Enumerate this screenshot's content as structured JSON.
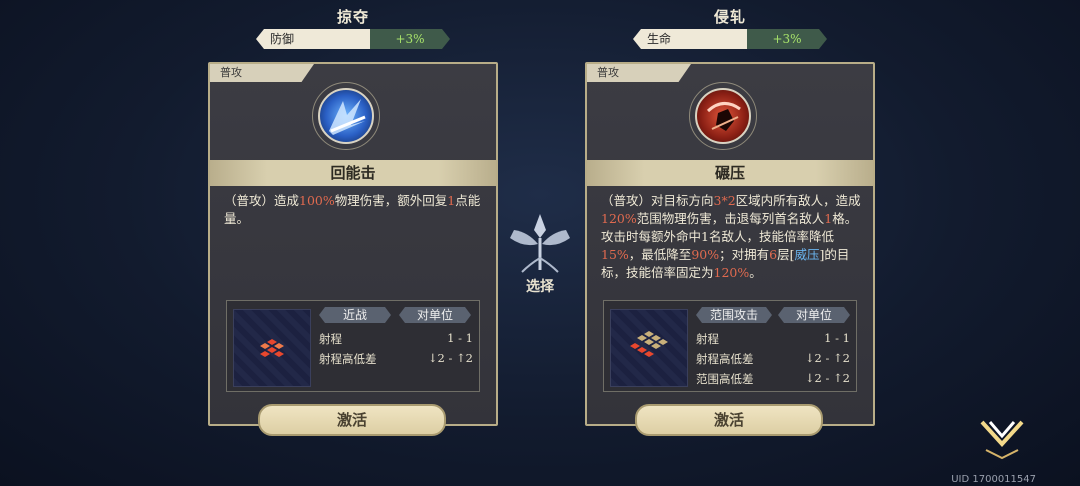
{
  "left": {
    "title": "掠夺",
    "stat_label": "防御",
    "stat_value": "+3%",
    "tag": "普攻",
    "skill_name": "回能击",
    "desc": [
      "（普攻）造成",
      "100%",
      "物理伤害，额外回复",
      "1",
      "点能量。"
    ],
    "type_pill": "近战",
    "target_pill": "对单位",
    "rows": [
      {
        "k": "射程",
        "v": "1 - 1"
      },
      {
        "k": "射程高低差",
        "v": "↓2 - ↑2"
      }
    ],
    "button": "激活"
  },
  "right": {
    "title": "侵轧",
    "stat_label": "生命",
    "stat_value": "+3%",
    "tag": "普攻",
    "skill_name": "碾压",
    "desc": [
      "（普攻）对目标方向",
      "3*2",
      "区域内所有敌人，造成",
      "120%",
      "范围物理伤害，击退每列首名敌人",
      "1",
      "格。攻击时每额外命中1名敌人，技能倍率降低",
      "15%",
      "，最低降至",
      "90%",
      "；对拥有",
      "6",
      "层[",
      "威压",
      "]的目标，技能倍率固定为",
      "120%",
      "。"
    ],
    "type_pill": "范围攻击",
    "target_pill": "对单位",
    "rows": [
      {
        "k": "射程",
        "v": "1 - 1"
      },
      {
        "k": "射程高低差",
        "v": "↓2 - ↑2"
      },
      {
        "k": "范围高低差",
        "v": "↓2 - ↑2"
      }
    ],
    "button": "激活"
  },
  "center_label": "选择",
  "uid": "UID 1700011547",
  "colors": {
    "highlight": "#e06a4f",
    "keyword": "#6ab4ee",
    "stat_value": "#a7e26a"
  }
}
